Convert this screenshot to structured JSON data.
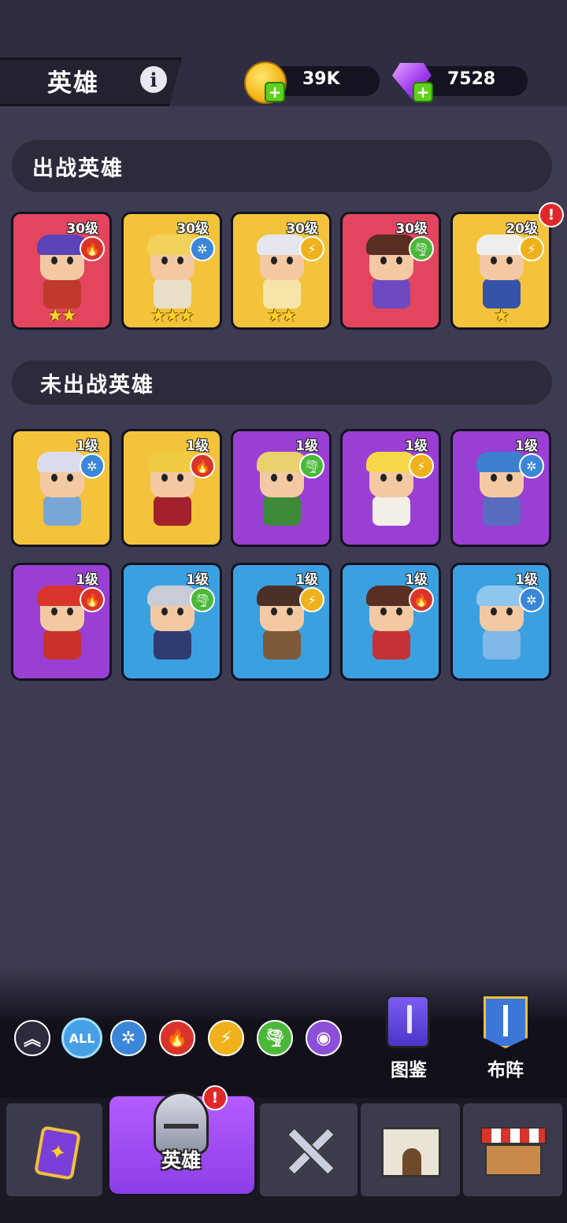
{
  "header": {
    "title": "英雄",
    "info_icon": "info-icon",
    "coins": "39K",
    "gems": "7528"
  },
  "deployed": {
    "section_title": "出战英雄",
    "heroes": [
      {
        "level": "30级",
        "element": "fire",
        "stars": 2,
        "bg": "#e3455f",
        "hair": "#5b44b7",
        "outfit": "#c0392b"
      },
      {
        "level": "30级",
        "element": "ice",
        "stars": 3,
        "bg": "#f3c33b",
        "hair": "#f1d15a",
        "outfit": "#e9e0c8"
      },
      {
        "level": "30级",
        "element": "lightning",
        "stars": 2,
        "bg": "#f3c33b",
        "hair": "#e6e6ef",
        "outfit": "#f7e4a8"
      },
      {
        "level": "30级",
        "element": "wind",
        "stars": 0,
        "bg": "#e3455f",
        "hair": "#5a2f23",
        "outfit": "#6e4ac2"
      },
      {
        "level": "20级",
        "element": "lightning",
        "stars": 1,
        "bg": "#f3c33b",
        "hair": "#eeeeee",
        "outfit": "#3553a8",
        "alert": true
      }
    ]
  },
  "undeployed": {
    "section_title": "未出战英雄",
    "heroes": [
      {
        "level": "1级",
        "element": "ice",
        "bg": "#f3c33b",
        "hair": "#d9dcef",
        "outfit": "#7aa6d6"
      },
      {
        "level": "1级",
        "element": "fire",
        "bg": "#f3c33b",
        "hair": "#f1cc43",
        "outfit": "#a2212d"
      },
      {
        "level": "1级",
        "element": "wind",
        "bg": "#9a3fd4",
        "hair": "#e8d06b",
        "outfit": "#3c8a37"
      },
      {
        "level": "1级",
        "element": "lightning",
        "bg": "#9a3fd4",
        "hair": "#f5d84a",
        "outfit": "#f2efe6"
      },
      {
        "level": "1级",
        "element": "ice",
        "bg": "#9a3fd4",
        "hair": "#3d7fcf",
        "outfit": "#5a6cc0"
      },
      {
        "level": "1级",
        "element": "fire",
        "bg": "#9a3fd4",
        "hair": "#d9342b",
        "outfit": "#c8322b"
      },
      {
        "level": "1级",
        "element": "wind",
        "bg": "#3aa0e0",
        "hair": "#c9ccd6",
        "outfit": "#2f3c72"
      },
      {
        "level": "1级",
        "element": "lightning",
        "bg": "#3aa0e0",
        "hair": "#4a2f26",
        "outfit": "#7e5a3b"
      },
      {
        "level": "1级",
        "element": "fire",
        "bg": "#3aa0e0",
        "hair": "#5a2f23",
        "outfit": "#c53134"
      },
      {
        "level": "1级",
        "element": "ice",
        "bg": "#3aa0e0",
        "hair": "#8ec6ef",
        "outfit": "#7fb7e6"
      }
    ]
  },
  "filters": [
    {
      "name": "collapse",
      "glyph": "︽",
      "bg": "#2c2a3b"
    },
    {
      "name": "all",
      "glyph": "ALL",
      "bg": "#46a0e6"
    },
    {
      "name": "ice",
      "glyph": "✲",
      "bg": "#3a86d8"
    },
    {
      "name": "fire",
      "glyph": "🔥",
      "bg": "#d9342b"
    },
    {
      "name": "lightning",
      "glyph": "⚡",
      "bg": "#f0b21c"
    },
    {
      "name": "wind",
      "glyph": "🌪",
      "bg": "#4cb83a"
    },
    {
      "name": "light",
      "glyph": "◉",
      "bg": "#8c4fd8"
    }
  ],
  "side_buttons": {
    "codex": "图鉴",
    "formation": "布阵"
  },
  "nav": {
    "heroes_label": "英雄"
  },
  "element_styles": {
    "fire": {
      "glyph": "🔥",
      "color": "#d9342b"
    },
    "ice": {
      "glyph": "✲",
      "color": "#3a86d8"
    },
    "lightning": {
      "glyph": "⚡",
      "color": "#f0b21c"
    },
    "wind": {
      "glyph": "🌪",
      "color": "#4cb83a"
    }
  }
}
